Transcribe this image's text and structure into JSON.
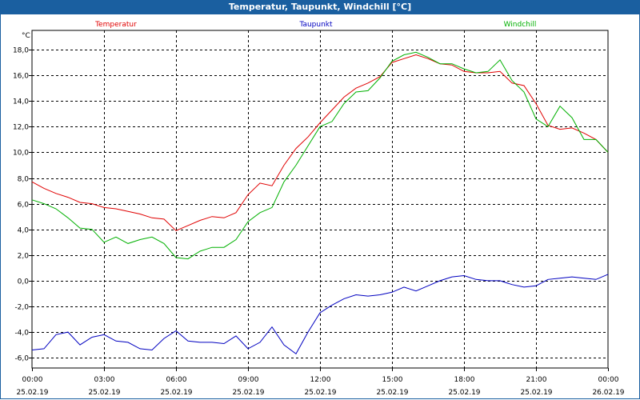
{
  "window": {
    "title": "Temperatur, Taupunkt, Windchill [°C]"
  },
  "colors": {
    "titlebar": "#1a5fa0",
    "temperatur": "#e00000",
    "taupunkt": "#0000c0",
    "windchill": "#00b000",
    "grid": "#000000"
  },
  "chart_data": {
    "type": "line",
    "title": "Temperatur, Taupunkt, Windchill [°C]",
    "ylabel": "°C",
    "ylim": [
      -6.8,
      19.5
    ],
    "yticks": [
      "18,0",
      "16,0",
      "14,0",
      "12,0",
      "10,0",
      "8,0",
      "6,0",
      "4,0",
      "2,0",
      "0,0",
      "-2,0",
      "-4,0",
      "-6,0"
    ],
    "ytick_values": [
      18,
      16,
      14,
      12,
      10,
      8,
      6,
      4,
      2,
      0,
      -2,
      -4,
      -6
    ],
    "xlim": [
      0,
      24
    ],
    "xticks": [
      {
        "time": "00:00",
        "date": "25.02.19"
      },
      {
        "time": "03:00",
        "date": "25.02.19"
      },
      {
        "time": "06:00",
        "date": "25.02.19"
      },
      {
        "time": "09:00",
        "date": "25.02.19"
      },
      {
        "time": "12:00",
        "date": "25.02.19"
      },
      {
        "time": "15:00",
        "date": "25.02.19"
      },
      {
        "time": "18:00",
        "date": "25.02.19"
      },
      {
        "time": "21:00",
        "date": "25.02.19"
      },
      {
        "time": "00:00",
        "date": "26.02.19"
      }
    ],
    "xtick_values": [
      0,
      3,
      6,
      9,
      12,
      15,
      18,
      21,
      24
    ],
    "grid": true,
    "legend": "top",
    "series": [
      {
        "name": "Temperatur",
        "color": "#e00000",
        "x": [
          0,
          0.5,
          1,
          1.5,
          2,
          2.5,
          3,
          3.5,
          4,
          4.5,
          5,
          5.5,
          6,
          6.5,
          7,
          7.5,
          8,
          8.5,
          9,
          9.5,
          10,
          10.5,
          11,
          11.5,
          12,
          12.5,
          13,
          13.5,
          14,
          14.5,
          15,
          15.5,
          16,
          16.5,
          17,
          17.5,
          18,
          18.5,
          19,
          19.5,
          20,
          20.5,
          21,
          21.5,
          22,
          22.5,
          23,
          23.5,
          24
        ],
        "y": [
          7.7,
          7.2,
          6.8,
          6.5,
          6.1,
          6.0,
          5.7,
          5.6,
          5.4,
          5.2,
          4.9,
          4.8,
          3.9,
          4.3,
          4.7,
          5.0,
          4.9,
          5.3,
          6.7,
          7.6,
          7.4,
          9.0,
          10.3,
          11.2,
          12.3,
          13.3,
          14.3,
          15.0,
          15.4,
          15.9,
          17.0,
          17.3,
          17.6,
          17.3,
          16.9,
          16.8,
          16.3,
          16.2,
          16.2,
          16.3,
          15.4,
          15.2,
          13.8,
          12.1,
          11.8,
          11.9,
          11.5,
          11.0,
          10.0
        ]
      },
      {
        "name": "Taupunkt",
        "color": "#0000c0",
        "x": [
          0,
          0.5,
          1,
          1.5,
          2,
          2.5,
          3,
          3.5,
          4,
          4.5,
          5,
          5.5,
          6,
          6.5,
          7,
          7.5,
          8,
          8.5,
          9,
          9.5,
          10,
          10.5,
          11,
          11.5,
          12,
          12.5,
          13,
          13.5,
          14,
          14.5,
          15,
          15.5,
          16,
          16.5,
          17,
          17.5,
          18,
          18.5,
          19,
          19.5,
          20,
          20.5,
          21,
          21.5,
          22,
          22.5,
          23,
          23.5,
          24
        ],
        "y": [
          -5.4,
          -5.3,
          -4.2,
          -4.0,
          -5.0,
          -4.4,
          -4.2,
          -4.7,
          -4.8,
          -5.3,
          -5.4,
          -4.5,
          -3.9,
          -4.7,
          -4.8,
          -4.8,
          -4.9,
          -4.3,
          -5.3,
          -4.8,
          -3.6,
          -5.0,
          -5.7,
          -4.0,
          -2.5,
          -1.9,
          -1.4,
          -1.1,
          -1.2,
          -1.1,
          -0.9,
          -0.5,
          -0.8,
          -0.4,
          0.0,
          0.3,
          0.4,
          0.1,
          0.0,
          0.0,
          -0.3,
          -0.5,
          -0.4,
          0.1,
          0.2,
          0.3,
          0.2,
          0.1,
          0.5
        ]
      },
      {
        "name": "Windchill",
        "color": "#00b000",
        "x": [
          0,
          0.5,
          1,
          1.5,
          2,
          2.5,
          3,
          3.5,
          4,
          4.5,
          5,
          5.5,
          6,
          6.5,
          7,
          7.5,
          8,
          8.5,
          9,
          9.5,
          10,
          10.5,
          11,
          11.5,
          12,
          12.5,
          13,
          13.5,
          14,
          14.5,
          15,
          15.5,
          16,
          16.5,
          17,
          17.5,
          18,
          18.5,
          19,
          19.5,
          20,
          20.5,
          21,
          21.5,
          22,
          22.5,
          23,
          23.5,
          24
        ],
        "y": [
          6.3,
          6.0,
          5.6,
          4.9,
          4.1,
          4.0,
          3.0,
          3.4,
          2.9,
          3.2,
          3.4,
          2.9,
          1.8,
          1.7,
          2.3,
          2.6,
          2.6,
          3.2,
          4.6,
          5.3,
          5.7,
          7.7,
          9.0,
          10.5,
          12.0,
          12.4,
          13.8,
          14.7,
          14.8,
          15.8,
          17.1,
          17.6,
          17.8,
          17.4,
          16.9,
          16.9,
          16.5,
          16.2,
          16.3,
          17.2,
          15.6,
          14.7,
          12.6,
          12.0,
          13.6,
          12.7,
          11.0,
          11.0,
          10.0
        ]
      }
    ]
  }
}
